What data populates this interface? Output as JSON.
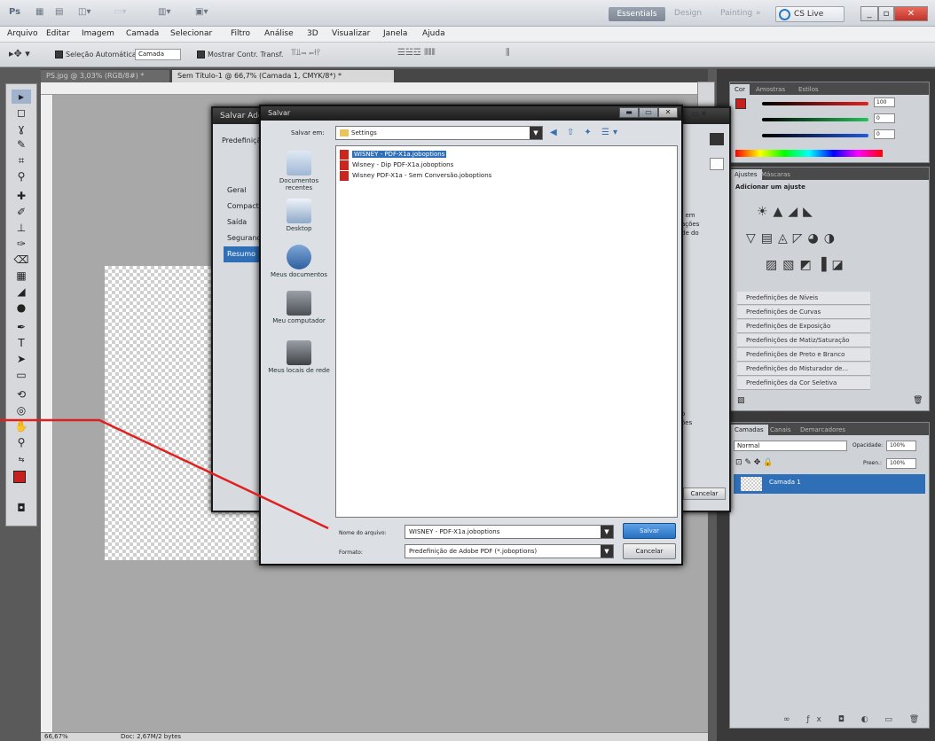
{
  "appbar": {
    "logo": "Ps",
    "workspace_essentials": "Essentials",
    "workspace_links": [
      "Design",
      "Painting"
    ],
    "more": "»",
    "cslive": "CS Live"
  },
  "menu": [
    "Arquivo",
    "Editar",
    "Imagem",
    "Camada",
    "Selecionar",
    "Filtro",
    "Análise",
    "3D",
    "Visualizar",
    "Janela",
    "Ajuda"
  ],
  "options": {
    "auto_select_label": "Seleção Automática:",
    "auto_select_value": "Camada",
    "show_transform_label": "Mostrar Contr. Transf."
  },
  "tabs": [
    {
      "label": "PS.jpg @ 3,03% (RGB/8#) *"
    },
    {
      "label": "Sem Título-1 @ 66,7% (Camada 1, CMYK/8*) *"
    }
  ],
  "status": {
    "zoom": "66,67%",
    "doc": "Doc: 2,67M/2 bytes"
  },
  "pdf_dialog": {
    "title": "Salvar Adobe PDF",
    "preset_label": "Predefinição",
    "sections": [
      "Geral",
      "Compactação",
      "Saída",
      "Segurança",
      "Resumo"
    ],
    "snippet": [
      ", em",
      "ações",
      "de do"
    ],
    "snippet2": [
      "o",
      "ões"
    ],
    "cancel": "Cancelar"
  },
  "save_dialog": {
    "title": "Salvar",
    "save_in_label": "Salvar em:",
    "save_in_value": "Settings",
    "places": [
      "Documentos recentes",
      "Desktop",
      "Meus documentos",
      "Meu computador",
      "Meus locais de rede"
    ],
    "files": [
      "WISNEY - PDF-X1a.joboptions",
      "Wisney - Dip PDF-X1a.joboptions",
      "Wisney PDF-X1a - Sem Conversão.joboptions"
    ],
    "filename_label": "Nome do arquivo:",
    "filename_value": "WISNEY - PDF-X1a.joboptions",
    "format_label": "Formato:",
    "format_value": "Predefinição de Adobe PDF (*.joboptions)",
    "save_btn": "Salvar",
    "cancel_btn": "Cancelar"
  },
  "panels": {
    "color_tabs": [
      "Cor",
      "Amostras",
      "Estilos"
    ],
    "adjust_tabs": [
      "Ajustes",
      "Máscaras"
    ],
    "adjust_hint": "Adicionar um ajuste",
    "presets": [
      "Predefinições de Níveis",
      "Predefinições de Curvas",
      "Predefinições de Exposição",
      "Predefinições de Matiz/Saturação",
      "Predefinições de Preto e Branco",
      "Predefinições do Misturador de...",
      "Predefinições da Cor Seletiva"
    ],
    "layers_tabs": [
      "Camadas",
      "Canais",
      "Demarcadores"
    ],
    "blend_mode": "Normal",
    "opacity_label": "Opacidade:",
    "opacity_value": "100%",
    "fill_label": "Preen.:",
    "fill_value": "100%",
    "layer_name": "Camada 1",
    "color_values": [
      "100",
      "0",
      "0"
    ]
  },
  "colors": {
    "accent": "#2f6fb8",
    "annotation": "#e02020"
  }
}
